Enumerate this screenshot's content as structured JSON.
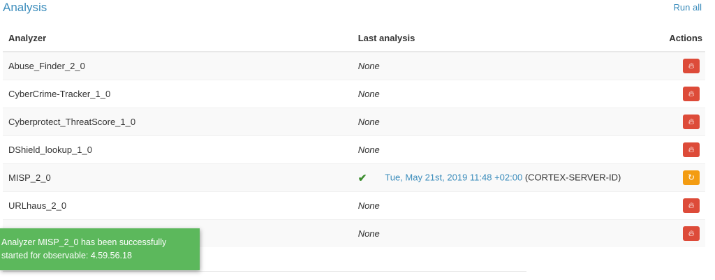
{
  "section": {
    "title": "Analysis",
    "run_all_label": "Run all"
  },
  "table": {
    "headers": {
      "analyzer": "Analyzer",
      "last_analysis": "Last analysis",
      "actions": "Actions"
    },
    "rows": [
      {
        "analyzer": "Abuse_Finder_2_0",
        "last_analysis": "None",
        "status": "none",
        "action_icon": "fire-icon",
        "action_color": "#dd4b39"
      },
      {
        "analyzer": "CyberCrime-Tracker_1_0",
        "last_analysis": "None",
        "status": "none",
        "action_icon": "fire-icon",
        "action_color": "#dd4b39"
      },
      {
        "analyzer": "Cyberprotect_ThreatScore_1_0",
        "last_analysis": "None",
        "status": "none",
        "action_icon": "fire-icon",
        "action_color": "#dd4b39"
      },
      {
        "analyzer": "DShield_lookup_1_0",
        "last_analysis": "None",
        "status": "none",
        "action_icon": "fire-icon",
        "action_color": "#dd4b39"
      },
      {
        "analyzer": "MISP_2_0",
        "last_analysis": "Tue, May 21st, 2019 11:48 +02:00",
        "server": "(CORTEX-SERVER-ID)",
        "status": "success",
        "status_icon": "check-icon",
        "action_icon": "refresh-icon",
        "action_color": "#f39c12"
      },
      {
        "analyzer": "URLhaus_2_0",
        "last_analysis": "None",
        "status": "none",
        "action_icon": "fire-icon",
        "action_color": "#dd4b39"
      },
      {
        "analyzer": "",
        "last_analysis": "None",
        "status": "none",
        "action_icon": "fire-icon",
        "action_color": "#dd4b39"
      }
    ]
  },
  "toast": {
    "line1": "Analyzer MISP_2_0 has been successfully",
    "line2": "started for observable: 4.59.56.18"
  },
  "colors": {
    "accent": "#3c8dbc",
    "danger": "#dd4b39",
    "warning": "#f39c12",
    "success_toast": "#5cb85c",
    "check": "#3c8d2f"
  }
}
